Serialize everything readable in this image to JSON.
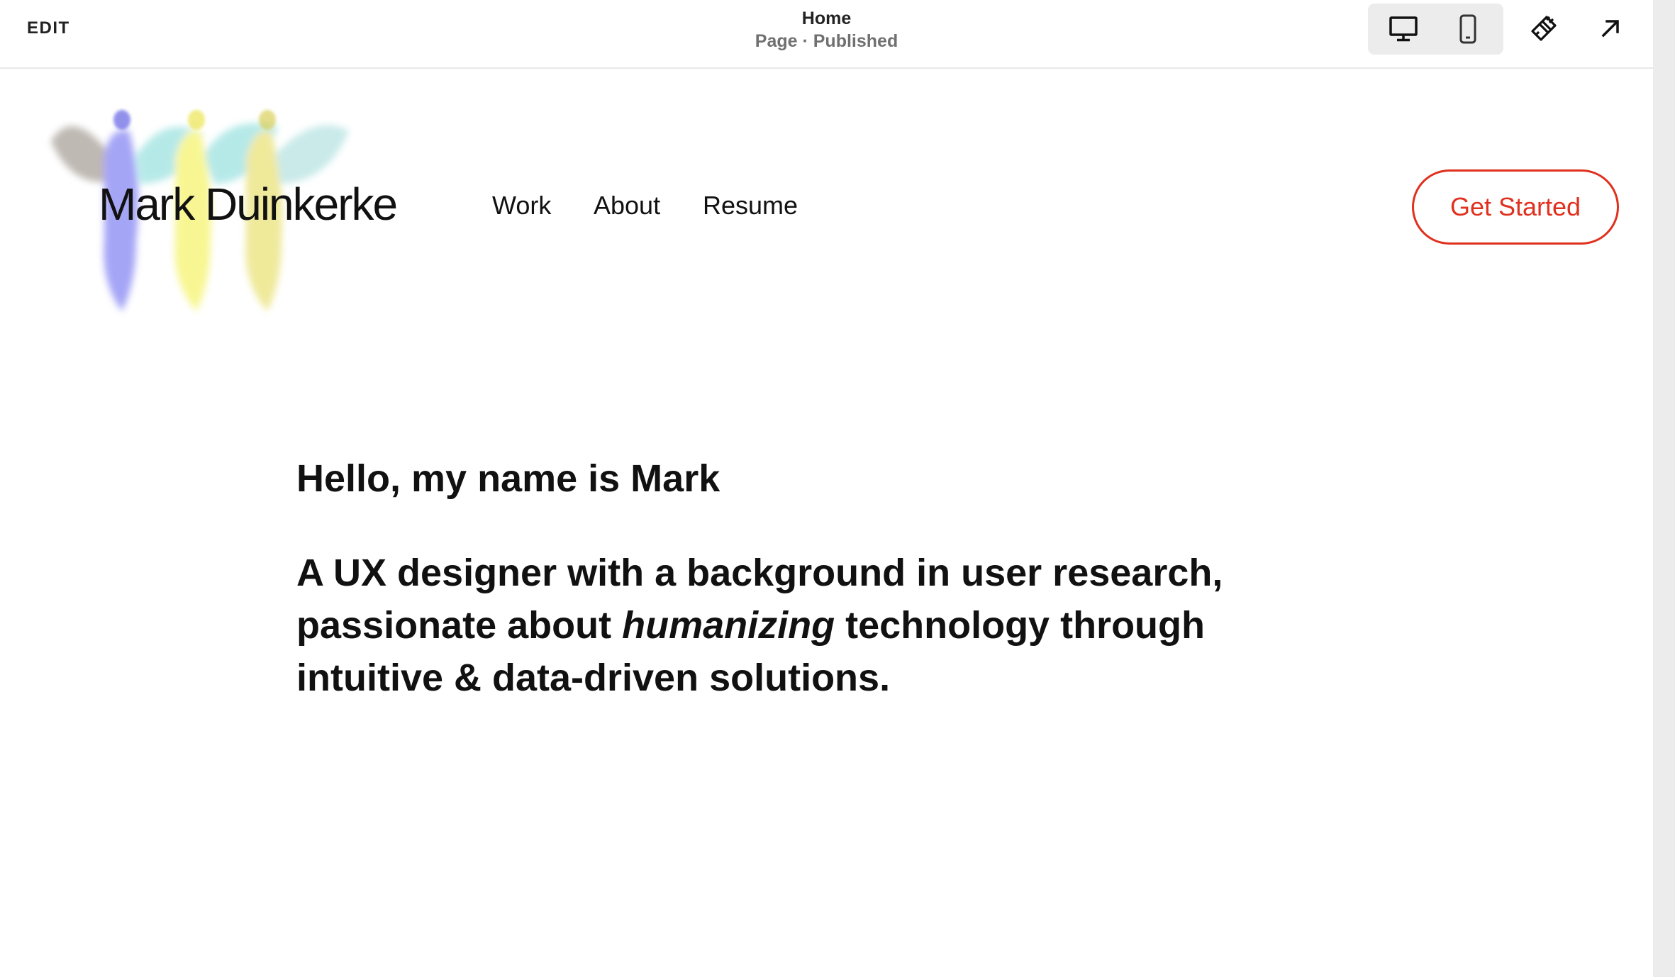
{
  "editor": {
    "edit_label": "EDIT",
    "page_title": "Home",
    "page_status": "Page · Published",
    "view_mode": "desktop",
    "tools": {
      "desktop_icon": "desktop-monitor-icon",
      "mobile_icon": "mobile-phone-icon",
      "design_icon": "paintbrush-icon",
      "exit_icon": "arrow-up-right-icon"
    }
  },
  "site": {
    "logo_text": "Mark Duinkerke",
    "nav": [
      {
        "label": "Work"
      },
      {
        "label": "About"
      },
      {
        "label": "Resume"
      }
    ],
    "cta_label": "Get Started",
    "colors": {
      "accent": "#e0301e",
      "text": "#111111"
    }
  },
  "content": {
    "greeting": "Hello, my name is Mark",
    "intro_part1": "A UX designer with a background in user research, passionate about ",
    "intro_emphasis": "humanizing",
    "intro_part2": " technology through intuitive & data-driven solutions."
  }
}
